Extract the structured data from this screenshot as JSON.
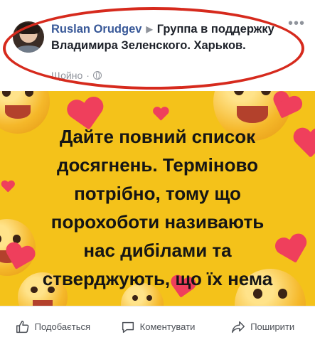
{
  "post": {
    "author": "Ruslan Orudgev",
    "group": "Группа в поддержку Владимира Зеленского. Харьков.",
    "timestamp": "Щойно",
    "privacy_icon": "globe-icon",
    "more_icon": "more-options-icon"
  },
  "image": {
    "text": "Дайте повний список досягнень. Терміново потрібно, тому що порохоботи називають нас дибілами та стверджують, що їх нема",
    "background_color": "#f4c21a",
    "highlight_color": "#d62a1d"
  },
  "actions": [
    {
      "label": "Подобається",
      "icon": "like-icon"
    },
    {
      "label": "Коментувати",
      "icon": "comment-icon"
    },
    {
      "label": "Поширити",
      "icon": "share-icon"
    }
  ]
}
